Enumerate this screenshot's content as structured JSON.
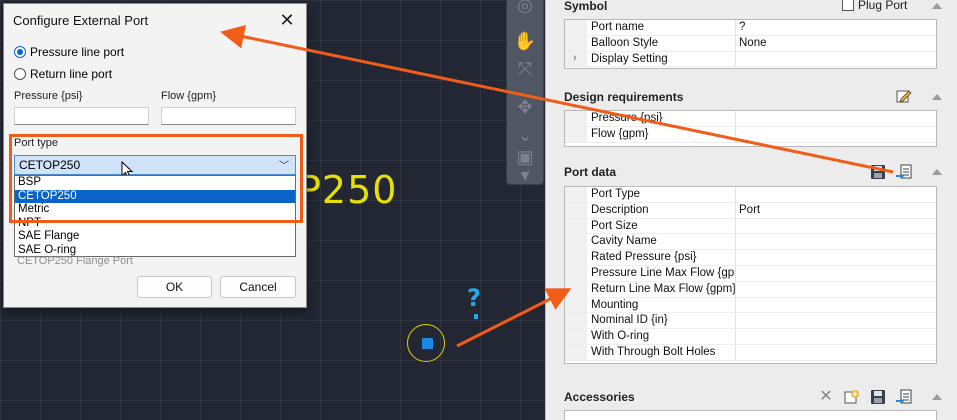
{
  "canvas": {
    "yellow_text": "P250",
    "blue_mark": "?"
  },
  "dialog": {
    "title": "Configure External Port",
    "radio_pressure": "Pressure line port",
    "radio_return": "Return line port",
    "pressure_label": "Pressure {psi}",
    "flow_label": "Flow {gpm}",
    "port_type_label": "Port type",
    "port_type_value": "CETOP250",
    "dropdown_options": [
      "BSP",
      "CETOP250",
      "Metric",
      "NPT",
      "SAE Flange",
      "SAE O-ring"
    ],
    "selected_option_index": 1,
    "description_preview": "CETOP250 Flange Port",
    "ok_label": "OK",
    "cancel_label": "Cancel"
  },
  "panel": {
    "symbol": {
      "header": "Symbol",
      "plug_port_label": "Plug Port",
      "rows": [
        {
          "name": "Port name",
          "value": "?"
        },
        {
          "name": "Balloon Style",
          "value": "None"
        },
        {
          "name": "Display Setting",
          "value": ""
        }
      ]
    },
    "design": {
      "header": "Design requirements",
      "rows": [
        {
          "name": "Pressure {psi}",
          "value": ""
        },
        {
          "name": "Flow {gpm}",
          "value": ""
        }
      ]
    },
    "port_data": {
      "header": "Port data",
      "rows": [
        {
          "name": "Port Type",
          "value": ""
        },
        {
          "name": "Description",
          "value": "Port"
        },
        {
          "name": "Port Size",
          "value": ""
        },
        {
          "name": "Cavity Name",
          "value": ""
        },
        {
          "name": "Rated Pressure {psi}",
          "value": ""
        },
        {
          "name": "Pressure Line Max Flow {gpm}",
          "value": ""
        },
        {
          "name": "Return Line Max Flow {gpm}",
          "value": ""
        },
        {
          "name": "Mounting",
          "value": ""
        },
        {
          "name": "Nominal ID {in}",
          "value": ""
        },
        {
          "name": "With O-ring",
          "value": ""
        },
        {
          "name": "With Through Bolt Holes",
          "value": ""
        }
      ]
    },
    "accessories": {
      "header": "Accessories"
    }
  },
  "colors": {
    "annotation": "#f25c19",
    "selection": "#0a64c8",
    "canvas_text": "#e8e000",
    "port_marker": "#1e88e5"
  }
}
